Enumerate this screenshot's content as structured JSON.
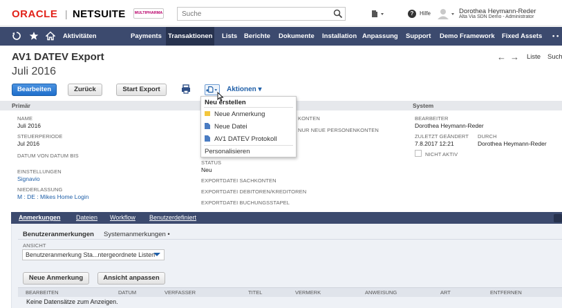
{
  "header": {
    "logo_oracle": "ORACLE",
    "logo_sep": "|",
    "logo_netsuite": "NETSUITE",
    "company_logo": "MULTIPHARMA",
    "search_placeholder": "Suche",
    "help_label": "Hilfe",
    "user_name": "Dorothea Heymann-Reder",
    "user_role": "Alta Via SDN Demo - Administrator"
  },
  "nav": {
    "items": [
      "Aktivitäten",
      "Payments",
      "Transaktionen",
      "Lists",
      "Berichte",
      "Dokumente",
      "Installation",
      "Anpassung",
      "Support",
      "Demo Framework",
      "Fixed Assets",
      "• •"
    ],
    "active_index": 2
  },
  "record": {
    "title": "AV1 DATEV Export",
    "name": "Juli 2016",
    "pager": {
      "list_label": "Liste",
      "search_label": "Suche"
    }
  },
  "toolbar": {
    "edit": "Bearbeiten",
    "back": "Zurück",
    "start_export": "Start Export",
    "actions": "Aktionen ▾"
  },
  "dropdown": {
    "heading": "Neu erstellen",
    "items": [
      "Neue Anmerkung",
      "Neue Datei",
      "AV1 DATEV Protokoll"
    ],
    "personalize": "Personalisieren"
  },
  "fields": {
    "section_primary": "Primär",
    "section_system": "System",
    "name_label": "NAME",
    "name_value": "Juli 2016",
    "period_label": "STEUERPERIODE",
    "period_value": "Jul 2016",
    "date_range_label": "DATUM VON  DATUM BIS",
    "settings_label": "EINSTELLUNGEN",
    "settings_value": "Signavio",
    "branch_label": "NIEDERLASSUNG",
    "branch_value": "M : DE : Mikes Home Login",
    "partial_konten": "KONTEN",
    "partial_personen": "NUR NEUE PERSONENKONTEN",
    "status_label": "STATUS",
    "status_value": "Neu",
    "export_sach": "EXPORTDATEI SACHKONTEN",
    "export_debitoren": "EXPORTDATEI DEBITOREN/KREDITOREN",
    "export_buchung": "EXPORTDATEI BUCHUNGSSTAPEL",
    "editor_label": "BEARBEITER",
    "editor_value": "Dorothea Heymann-Reder",
    "changed_label": "ZULETZT GEÄNDERT",
    "changed_value": "7.8.2017 12:21",
    "by_label": "DURCH",
    "by_value": "Dorothea Heymann-Reder",
    "inactive_label": "NICHT AKTIV"
  },
  "subtabs": [
    "Anmerkungen",
    "Dateien",
    "Workflow",
    "Benutzerdefiniert"
  ],
  "notes_panel": {
    "inner_tabs": [
      "Benutzeranmerkungen",
      "Systemanmerkungen •"
    ],
    "view_label": "ANSICHT",
    "view_value": "Benutzeranmerkung Sta...ntergeordnete Listen",
    "new_note_button": "Neue Anmerkung",
    "customize_button": "Ansicht anpassen",
    "columns": [
      "BEARBEITEN",
      "DATUM",
      "VERFASSER",
      "TITEL",
      "VERMERK",
      "ANWEISUNG",
      "ART",
      "ENTFERNEN"
    ],
    "empty_text": "Keine Datensätze zum Anzeigen."
  },
  "colors": {
    "nav_bg": "#3c4a6e",
    "nav_active": "#27324e",
    "primary_button": "#1f6fcc",
    "link": "#1f5fa8",
    "oracle_red": "#e2231a"
  }
}
